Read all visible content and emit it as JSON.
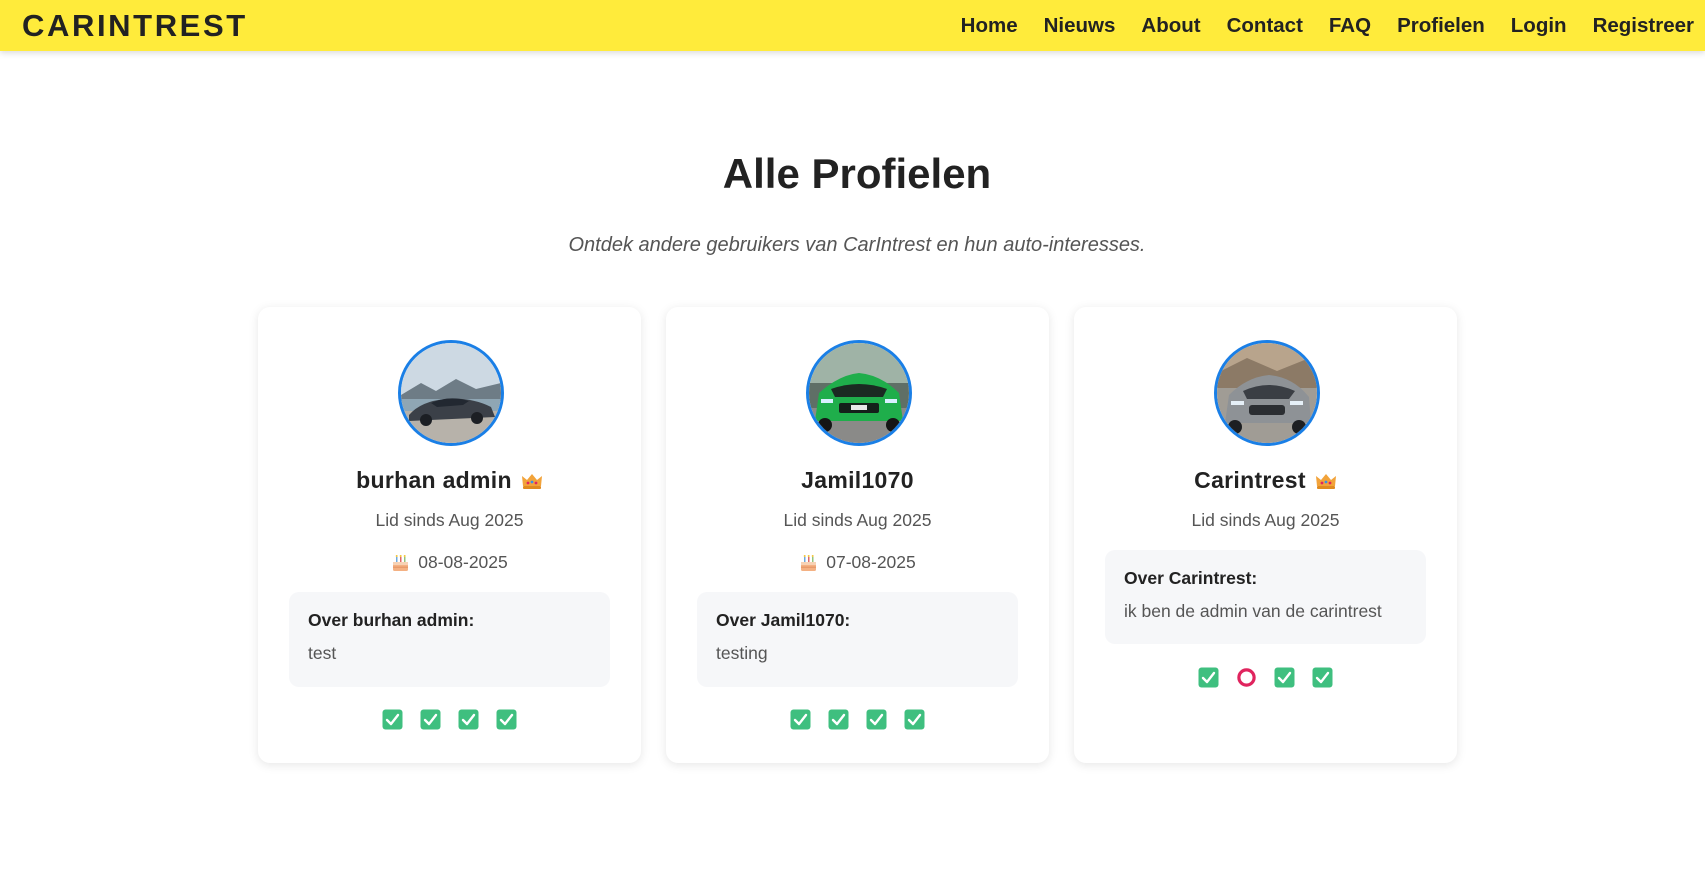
{
  "nav": {
    "logo": "CARINTREST",
    "links": [
      "Home",
      "Nieuws",
      "About",
      "Contact",
      "FAQ",
      "Profielen",
      "Login",
      "Registreer"
    ]
  },
  "page": {
    "title": "Alle Profielen",
    "subtitle": "Ontdek andere gebruikers van CarIntrest en hun auto-interesses."
  },
  "profiles": [
    {
      "name": "burhan admin",
      "is_admin": true,
      "member_since": "Lid sinds Aug 2025",
      "birthday": "08-08-2025",
      "about_label": "Over burhan admin:",
      "about_text": "test",
      "avatar_icon": "grey-sports-car-photo",
      "statuses": [
        "check",
        "check",
        "check",
        "check"
      ]
    },
    {
      "name": "Jamil1070",
      "is_admin": false,
      "member_since": "Lid sinds Aug 2025",
      "birthday": "07-08-2025",
      "about_label": "Over Jamil1070:",
      "about_text": "testing",
      "avatar_icon": "green-car-photo",
      "statuses": [
        "check",
        "check",
        "check",
        "check"
      ]
    },
    {
      "name": "Carintrest",
      "is_admin": true,
      "member_since": "Lid sinds Aug 2025",
      "birthday": "",
      "about_label": "Over Carintrest:",
      "about_text": "ik ben de admin van de carintrest",
      "avatar_icon": "silver-sedan-photo",
      "statuses": [
        "check",
        "circle",
        "check",
        "check"
      ]
    }
  ],
  "colors": {
    "navbar_bg": "#ffeb3b",
    "avatar_border": "#1a7fe6",
    "check_green": "#3fbf7f",
    "circle_red": "#e0245e",
    "about_bg": "#f6f7f9"
  }
}
